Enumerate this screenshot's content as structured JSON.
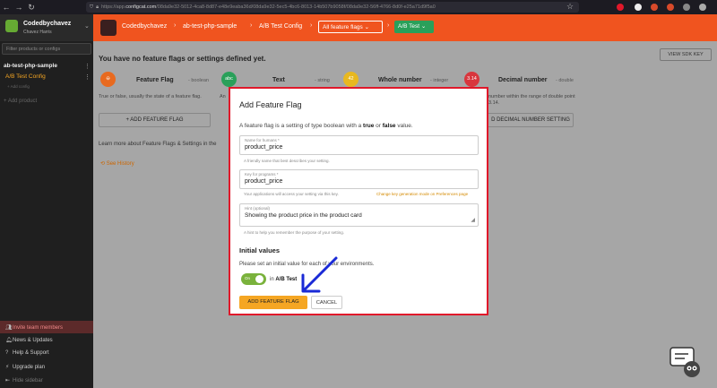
{
  "browser": {
    "url_prefix": "https://app.",
    "url_domain": "configcat.com",
    "url_rest": "/08da9e32-5012-4ca8-8d87-e48e9eaba36d/08da9e32-5ec5-4bc6-8013-14b507b9058f/08da9e32-56ff-4766-8d0f-e25a71d9f5a0"
  },
  "sidebar": {
    "org_name": "Codedbychavez",
    "user_name": "Chavez Harris",
    "filter_placeholder": "Filter products or configs",
    "product": "ab-test-php-sample",
    "config": "A/B Test Config",
    "add_config": "+ Add config",
    "add_product": "+ Add product",
    "invite": "Invite team members",
    "news": "News & Updates",
    "help": "Help & Support",
    "upgrade": "Upgrade plan",
    "hide": "Hide sidebar"
  },
  "header": {
    "org": "Codedbychavez",
    "product": "ab-test-php-sample",
    "config": "A/B Test Config",
    "filter_select": "All feature flags",
    "environment": "A/B Test"
  },
  "main": {
    "empty_title": "You have no feature flags or settings defined yet.",
    "view_sdk_key": "VIEW SDK KEY",
    "types": [
      {
        "icon": "",
        "name": "Feature Flag",
        "kind": "- boolean",
        "color": "#e86a1f"
      },
      {
        "icon": "abc",
        "name": "Text",
        "kind": "- string",
        "color": "#2aa05a"
      },
      {
        "icon": "42",
        "name": "Whole number",
        "kind": "- integer",
        "color": "#e8b820"
      },
      {
        "icon": "3.14",
        "name": "Decimal number",
        "kind": "- double",
        "color": "#d8363d"
      }
    ],
    "bool_desc": "True or false, usually the state of a feature flag.",
    "text_desc_partial": "An",
    "decimal_desc": "number within the range of double point 3.14.",
    "add_feature_flag_bg": "+ ADD FEATURE FLAG",
    "add_decimal_bg": "D DECIMAL NUMBER SETTING",
    "learn_more": "Learn more about Feature Flags & Settings in the",
    "see_history": "See History"
  },
  "modal": {
    "title": "Add Feature Flag",
    "desc_pre": "A feature flag is a setting of type boolean with a",
    "desc_true": "true",
    "desc_or": "or",
    "desc_false": "false",
    "desc_post": "value.",
    "name_label": "Name for humans *",
    "name_value": "product_price",
    "name_help": "A friendly name that best describes your setting.",
    "key_label": "Key for programs *",
    "key_value": "product_price",
    "key_help": "Your applications will access your setting via this key.",
    "key_help_right": "Change key generation mode on Preferences page",
    "hint_label": "Hint (optional)",
    "hint_value": "Showing the product price in the product card",
    "hint_help": "A hint to help you remember the purpose of your setting.",
    "initial_title": "Initial values",
    "initial_desc": "Please set an initial value for each of your environments.",
    "toggle_label": "On",
    "toggle_on": true,
    "env_in": "in",
    "env_name": "A/B Test",
    "primary_btn": "ADD FEATURE FLAG",
    "cancel_btn": "CANCEL"
  },
  "colors": {
    "accent": "#f0541f",
    "highlight_border": "#e0182a",
    "primary_button": "#f5a623",
    "toggle_on": "#7ab23c",
    "annotation_arrow": "#1a2ad6"
  }
}
